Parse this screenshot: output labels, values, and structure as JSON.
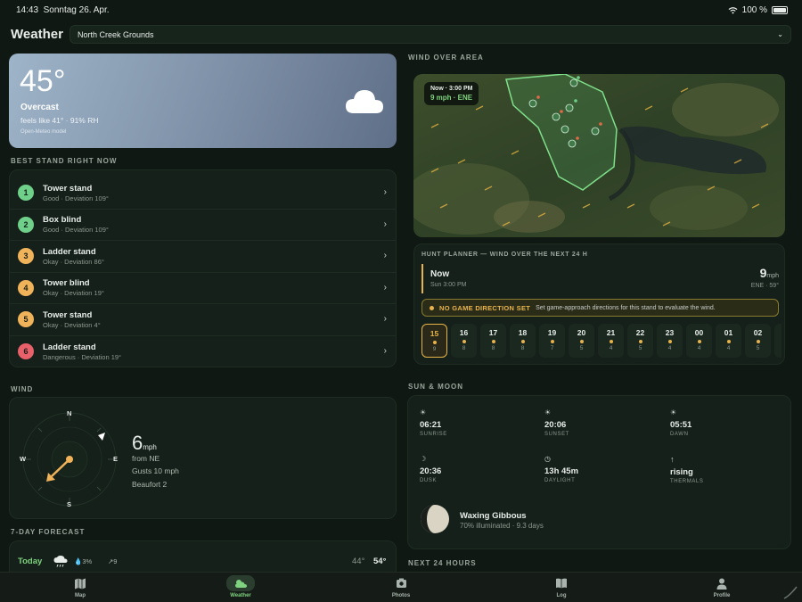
{
  "status_bar": {
    "time": "14:43",
    "date": "Sonntag 26. Apr.",
    "battery": "100 %"
  },
  "header": {
    "title": "Weather",
    "location": "North Creek Grounds"
  },
  "current": {
    "temperature": "45°",
    "condition": "Overcast",
    "feels": "feels like 41° · 91% RH",
    "model": "Open-Meteo model",
    "icon": "cloud-icon"
  },
  "sections": {
    "best_stand": "BEST STAND RIGHT NOW",
    "wind": "WIND",
    "forecast": "7-DAY FORECAST",
    "wind_over_area": "WIND OVER AREA",
    "sun_moon": "SUN & MOON",
    "next_24": "NEXT 24 HOURS"
  },
  "stands": [
    {
      "rank": "1",
      "name": "Tower stand",
      "detail": "Good · Deviation 109°",
      "color": "#6fd08a"
    },
    {
      "rank": "2",
      "name": "Box blind",
      "detail": "Good · Deviation 109°",
      "color": "#6fd08a"
    },
    {
      "rank": "3",
      "name": "Ladder stand",
      "detail": "Okay · Deviation 86°",
      "color": "#f0b35a"
    },
    {
      "rank": "4",
      "name": "Tower blind",
      "detail": "Okay · Deviation 19°",
      "color": "#f0b35a"
    },
    {
      "rank": "5",
      "name": "Tower stand",
      "detail": "Okay · Deviation 4°",
      "color": "#f0b35a"
    },
    {
      "rank": "6",
      "name": "Ladder stand",
      "detail": "Dangerous · Deviation 19°",
      "color": "#e8606a"
    }
  ],
  "wind": {
    "compass": {
      "n": "N",
      "e": "E",
      "s": "S",
      "w": "W"
    },
    "speed": "6",
    "unit": "mph",
    "from": "from NE",
    "gusts": "Gusts 10 mph",
    "beaufort": "Beaufort 2"
  },
  "forecast": {
    "day": "Today",
    "precip": "3%",
    "wind": "9",
    "low": "44°",
    "high": "54°"
  },
  "map": {
    "time": "Now · 3:00 PM",
    "wind": "9 mph · ENE"
  },
  "planner": {
    "title": "HUNT PLANNER — WIND OVER THE NEXT 24 H",
    "now_label": "Now",
    "now_time": "Sun 3:00 PM",
    "now_speed": "9",
    "now_unit": "mph",
    "now_dir": "ENE · 59°",
    "alert_title": "NO GAME DIRECTION SET",
    "alert_text": "Set game-approach directions for this stand to evaluate the wind.",
    "hours": [
      {
        "hour": "15",
        "speed": "9"
      },
      {
        "hour": "16",
        "speed": "8"
      },
      {
        "hour": "17",
        "speed": "8"
      },
      {
        "hour": "18",
        "speed": "8"
      },
      {
        "hour": "19",
        "speed": "7"
      },
      {
        "hour": "20",
        "speed": "5"
      },
      {
        "hour": "21",
        "speed": "4"
      },
      {
        "hour": "22",
        "speed": "5"
      },
      {
        "hour": "23",
        "speed": "4"
      },
      {
        "hour": "00",
        "speed": "4"
      },
      {
        "hour": "01",
        "speed": "4"
      },
      {
        "hour": "02",
        "speed": "5"
      }
    ]
  },
  "sun_moon": {
    "items": [
      {
        "value": "06:21",
        "label": "SUNRISE",
        "icon": "sunrise-icon"
      },
      {
        "value": "20:06",
        "label": "SUNSET",
        "icon": "sunset-icon"
      },
      {
        "value": "05:51",
        "label": "DAWN",
        "icon": "dawn-icon"
      },
      {
        "value": "20:36",
        "label": "DUSK",
        "icon": "dusk-icon"
      },
      {
        "value": "13h 45m",
        "label": "DAYLIGHT",
        "icon": "clock-icon"
      },
      {
        "value": "rising",
        "label": "THERMALS",
        "icon": "arrow-up-icon"
      }
    ],
    "moon_phase": "Waxing Gibbous",
    "moon_detail": "70% illuminated · 9.3 days"
  },
  "tabs": [
    {
      "label": "Map",
      "icon": "map-icon"
    },
    {
      "label": "Weather",
      "icon": "weather-icon"
    },
    {
      "label": "Photos",
      "icon": "camera-icon"
    },
    {
      "label": "Log",
      "icon": "book-icon"
    },
    {
      "label": "Profile",
      "icon": "person-icon"
    }
  ]
}
